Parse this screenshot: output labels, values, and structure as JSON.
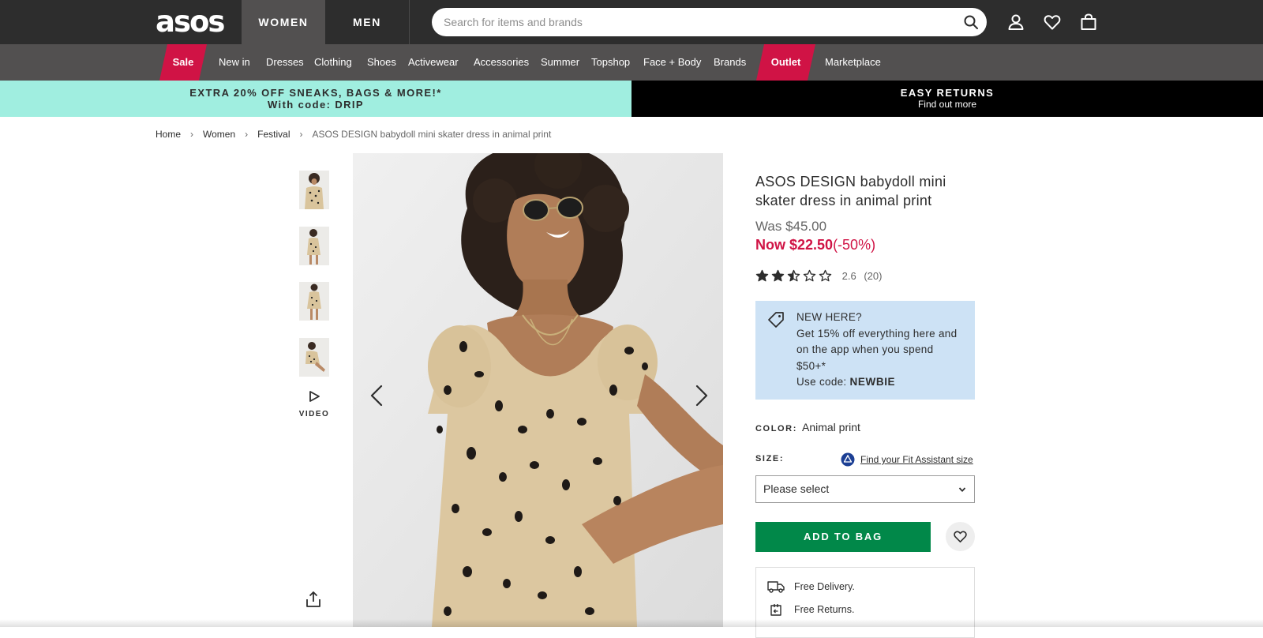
{
  "header": {
    "logo": "asos",
    "gender_tabs": [
      "WOMEN",
      "MEN"
    ],
    "search_placeholder": "Search for items and brands",
    "icons": [
      "search-icon",
      "account-icon",
      "heart-icon",
      "bag-icon"
    ]
  },
  "nav": {
    "items": [
      "Sale",
      "New in",
      "Dresses",
      "Clothing",
      "Shoes",
      "Activewear",
      "Accessories",
      "Summer",
      "Topshop",
      "Face + Body",
      "Brands",
      "Outlet",
      "Marketplace"
    ],
    "highlight_color": "#d01345"
  },
  "promo": {
    "left_line1": "EXTRA 20% OFF SNEAKS, BAGS & MORE!*",
    "left_line2": "With code: DRIP",
    "right_line1": "EASY RETURNS",
    "right_line2": "Find out more"
  },
  "breadcrumb": [
    "Home",
    "Women",
    "Festival",
    "ASOS DESIGN babydoll mini skater dress in animal print"
  ],
  "gallery": {
    "video_label": "VIDEO",
    "icons": [
      "play-icon",
      "share-icon",
      "arrow-left-icon",
      "arrow-right-icon"
    ]
  },
  "product": {
    "title": "ASOS DESIGN babydoll mini skater dress in animal print",
    "was_price": "Was $45.00",
    "now_price": "Now $22.50",
    "discount": "(-50%)",
    "rating": "2.6",
    "rating_value": 2.6,
    "review_count": "(20)",
    "new_here": {
      "heading": "NEW HERE?",
      "body": "Get 15% off everything here and on the app when you spend $50+*",
      "code_prefix": "Use code: ",
      "code": "NEWBIE"
    },
    "color_label": "COLOR:",
    "color_value": "Animal print",
    "size_label": "SIZE:",
    "fit_assistant": "Find your Fit Assistant size",
    "size_select": "Please select",
    "add_to_bag": "ADD TO BAG",
    "delivery": [
      "Free Delivery.",
      "Free Returns."
    ]
  },
  "colors": {
    "header_bg": "#2d2d2d",
    "nav_bg": "#525050",
    "promo_mint": "#a0eee0",
    "sale_red": "#d01345",
    "add_green": "#018849",
    "newhere_blue": "#cde2f5"
  }
}
